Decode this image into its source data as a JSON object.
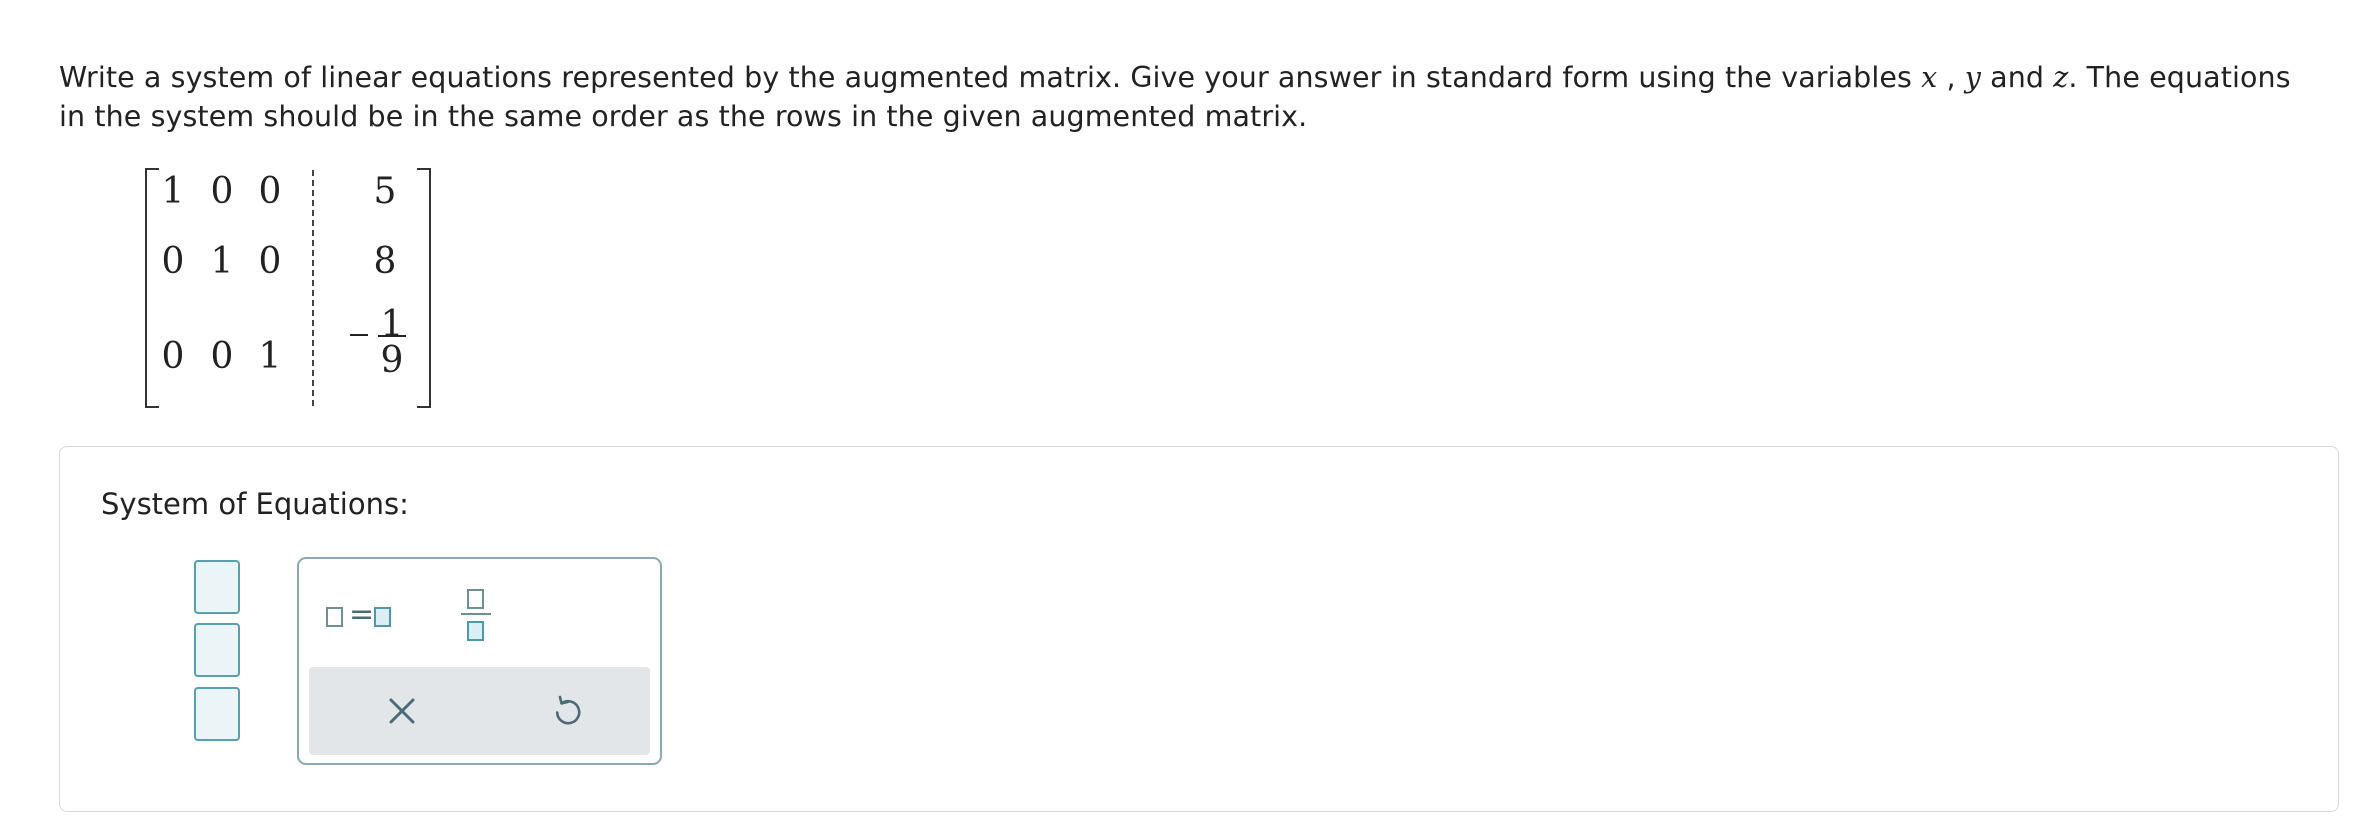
{
  "prompt": {
    "part1": "Write a system of linear equations represented by the augmented matrix. Give your answer in standard form using the variables ",
    "var_x": "x",
    "sep1": " , ",
    "var_y": "y",
    "sep2": " and ",
    "var_z": "z",
    "part2": ". The equations in the system should be in the same order as the rows in the given augmented matrix."
  },
  "matrix": {
    "rows": [
      [
        "1",
        "0",
        "0",
        "5"
      ],
      [
        "0",
        "1",
        "0",
        "8"
      ],
      [
        "0",
        "0",
        "1",
        "-1/9"
      ]
    ],
    "last_entry": {
      "sign": "−",
      "numerator": "1",
      "denominator": "9"
    }
  },
  "answer_panel": {
    "title": "System of Equations:",
    "answer_fields": [
      "",
      "",
      ""
    ]
  },
  "palette": {
    "buttons": [
      "equation-template",
      "fraction-template"
    ],
    "eq_sign": "=",
    "actions": [
      "clear",
      "undo"
    ]
  },
  "colors": {
    "field_border": "#5a9fae",
    "field_fill": "#ebf5f8",
    "palette_border": "#8aa9b6",
    "palette_footer": "#e2e6e8",
    "icon": "#4a6b78"
  }
}
